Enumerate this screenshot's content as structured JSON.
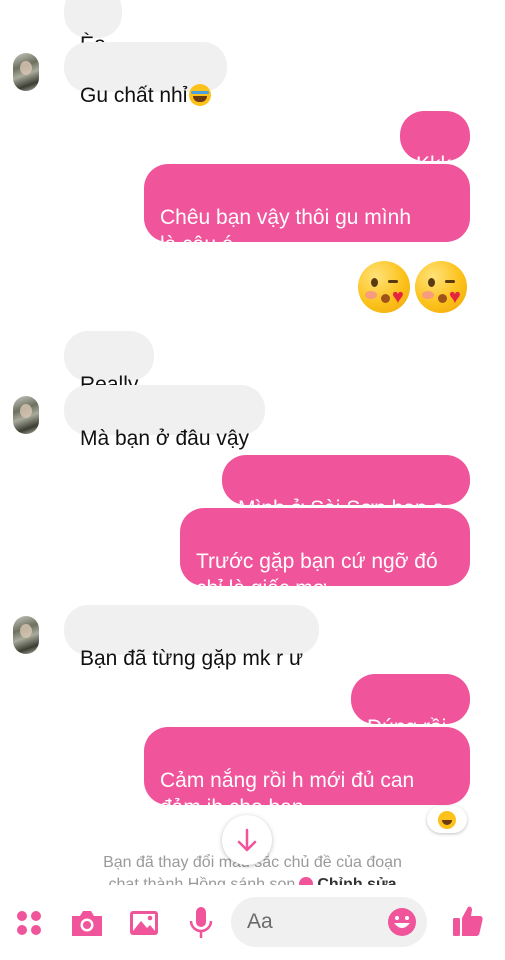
{
  "messages": [
    {
      "side": "in",
      "text": "Èo"
    },
    {
      "side": "in",
      "text": "Gu chất nhỉ",
      "emoji": "laughing-tears-emoji"
    },
    {
      "side": "out",
      "text": "Kkk"
    },
    {
      "side": "out",
      "text": "Chêu bạn vậy thôi gu mình\nlà cậu á"
    },
    {
      "side": "out",
      "emoji": [
        "kiss-heart-emoji",
        "kiss-heart-emoji"
      ]
    },
    {
      "side": "in",
      "text": "Really"
    },
    {
      "side": "in",
      "text": "Mà bạn ở đâu vậy"
    },
    {
      "side": "out",
      "text": "Mình ở Sài Sơn bạn ạ"
    },
    {
      "side": "out",
      "text": "Trước gặp bạn cứ ngỡ đó\nchỉ là giấc mơ....."
    },
    {
      "side": "in",
      "text": "Bạn đã từng gặp mk r ư"
    },
    {
      "side": "out",
      "text": "Đúng rồi"
    },
    {
      "side": "out",
      "text": "Cảm nắng rồi h mới đủ can\nđảm ib cho bạn",
      "reaction": "laughing-emoji"
    }
  ],
  "notice": {
    "line1": "Bạn đã thay đổi màu sắc chủ đề của đoạn",
    "line2": "chat thành Hồng sánh son",
    "edit": "Chỉnh sửa"
  },
  "composer": {
    "placeholder": "Aa",
    "icons": [
      "menu-dots-icon",
      "camera-icon",
      "image-icon",
      "microphone-icon",
      "emoji-icon",
      "thumbs-up-icon"
    ]
  },
  "colors": {
    "accent": "#f0549b",
    "incoming_bubble": "#f1f0f0"
  }
}
